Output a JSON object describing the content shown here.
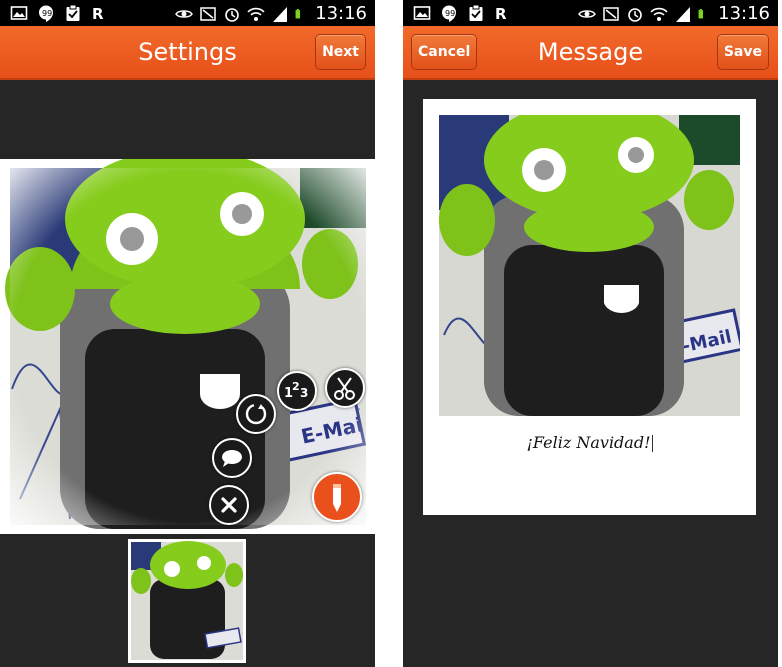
{
  "status_bar": {
    "time": "13:16",
    "icons": [
      "picture-icon",
      "hangouts-icon",
      "clipboard-check-icon",
      "r-app-icon",
      "eye-icon",
      "nfc-icon",
      "alarm-icon",
      "wifi-icon",
      "signal-icon",
      "battery-icon"
    ]
  },
  "settings_screen": {
    "title": "Settings",
    "next_label": "Next",
    "tools": [
      "rotate-icon",
      "numbering-icon",
      "cut-icon",
      "speech-bubble-icon",
      "close-icon",
      "pencil-icon"
    ]
  },
  "message_screen": {
    "title": "Message",
    "cancel_label": "Cancel",
    "save_label": "Save",
    "message_text": "¡Feliz Navidad!"
  },
  "colors": {
    "actionbar": "#ef5a1f",
    "background": "#262626",
    "accent_button": "#e9501c"
  }
}
